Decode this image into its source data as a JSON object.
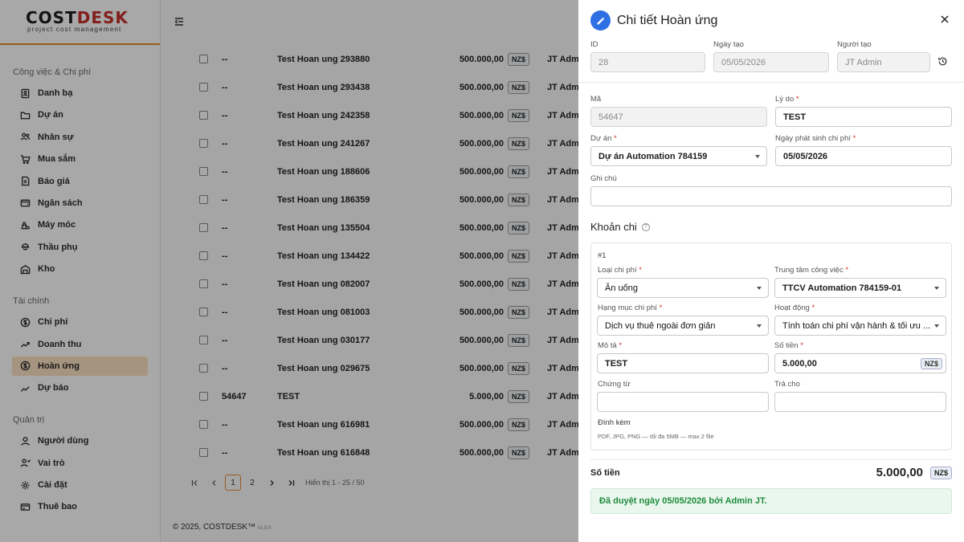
{
  "brand": {
    "name_a": "COST",
    "name_b": "DESK",
    "tagline": "project cost management"
  },
  "sidebar": {
    "sections": [
      {
        "title": "Công việc & Chi phí",
        "items": [
          {
            "label": "Danh bạ",
            "icon": "contacts-icon"
          },
          {
            "label": "Dự án",
            "icon": "folder-icon"
          },
          {
            "label": "Nhân sự",
            "icon": "people-icon"
          },
          {
            "label": "Mua sắm",
            "icon": "cart-icon"
          },
          {
            "label": "Báo giá",
            "icon": "quote-icon"
          },
          {
            "label": "Ngân sách",
            "icon": "budget-icon"
          },
          {
            "label": "Máy móc",
            "icon": "machine-icon"
          },
          {
            "label": "Thầu phụ",
            "icon": "contractor-icon"
          },
          {
            "label": "Kho",
            "icon": "warehouse-icon"
          }
        ]
      },
      {
        "title": "Tài chính",
        "items": [
          {
            "label": "Chi phí",
            "icon": "expense-icon"
          },
          {
            "label": "Doanh thu",
            "icon": "revenue-icon"
          },
          {
            "label": "Hoàn ứng",
            "icon": "refund-icon",
            "active": true
          },
          {
            "label": "Dự báo",
            "icon": "forecast-icon"
          }
        ]
      },
      {
        "title": "Quản trị",
        "items": [
          {
            "label": "Người dùng",
            "icon": "user-icon"
          },
          {
            "label": "Vai trò",
            "icon": "role-icon"
          },
          {
            "label": "Cài đặt",
            "icon": "gear-icon"
          },
          {
            "label": "Thuê bao",
            "icon": "subscription-icon"
          }
        ]
      }
    ]
  },
  "list": {
    "rows": [
      {
        "code": "--",
        "desc": "Test Hoan ung 293880",
        "amount": "500.000,00",
        "currency": "NZ$",
        "user": "JT Adm"
      },
      {
        "code": "--",
        "desc": "Test Hoan ung 293438",
        "amount": "500.000,00",
        "currency": "NZ$",
        "user": "JT Adm"
      },
      {
        "code": "--",
        "desc": "Test Hoan ung 242358",
        "amount": "500.000,00",
        "currency": "NZ$",
        "user": "JT Adm"
      },
      {
        "code": "--",
        "desc": "Test Hoan ung 241267",
        "amount": "500.000,00",
        "currency": "NZ$",
        "user": "JT Adm"
      },
      {
        "code": "--",
        "desc": "Test Hoan ung 188606",
        "amount": "500.000,00",
        "currency": "NZ$",
        "user": "JT Adm"
      },
      {
        "code": "--",
        "desc": "Test Hoan ung 186359",
        "amount": "500.000,00",
        "currency": "NZ$",
        "user": "JT Adm"
      },
      {
        "code": "--",
        "desc": "Test Hoan ung 135504",
        "amount": "500.000,00",
        "currency": "NZ$",
        "user": "JT Adm"
      },
      {
        "code": "--",
        "desc": "Test Hoan ung 134422",
        "amount": "500.000,00",
        "currency": "NZ$",
        "user": "JT Adm"
      },
      {
        "code": "--",
        "desc": "Test Hoan ung 082007",
        "amount": "500.000,00",
        "currency": "NZ$",
        "user": "JT Adm"
      },
      {
        "code": "--",
        "desc": "Test Hoan ung 081003",
        "amount": "500.000,00",
        "currency": "NZ$",
        "user": "JT Adm"
      },
      {
        "code": "--",
        "desc": "Test Hoan ung 030177",
        "amount": "500.000,00",
        "currency": "NZ$",
        "user": "JT Adm"
      },
      {
        "code": "--",
        "desc": "Test Hoan ung 029675",
        "amount": "500.000,00",
        "currency": "NZ$",
        "user": "JT Adm"
      },
      {
        "code": "54647",
        "desc": "TEST",
        "amount": "5.000,00",
        "currency": "NZ$",
        "user": "JT Adm"
      },
      {
        "code": "--",
        "desc": "Test Hoan ung 616981",
        "amount": "500.000,00",
        "currency": "NZ$",
        "user": "JT Adm"
      },
      {
        "code": "--",
        "desc": "Test Hoan ung 616848",
        "amount": "500.000,00",
        "currency": "NZ$",
        "user": "JT Adm"
      }
    ],
    "pager": {
      "current": "1",
      "next": "2",
      "info": "Hiển thị 1 - 25 / 50"
    },
    "footer": "© 2025, COSTDESK™",
    "version": "v1.0.0"
  },
  "drawer": {
    "title": "Chi tiết Hoàn ứng",
    "id_label": "ID",
    "id_value": "28",
    "created_label": "Ngày tạo",
    "created_value": "05/05/2026",
    "creator_label": "Người tạo",
    "creator_value": "JT Admin",
    "code_label": "Mã",
    "code_value": "54647",
    "reason_label": "Lý do",
    "reason_value": "TEST",
    "project_label": "Dự án",
    "project_value": "Dự án Automation 784159",
    "date_label": "Ngày phát sinh chi phí",
    "date_value": "05/05/2026",
    "note_label": "Ghi chú",
    "note_value": "",
    "section_title": "Khoản chi",
    "item": {
      "index": "#1",
      "type_label": "Loại chi phí",
      "type_value": "Ăn uống",
      "center_label": "Trung tâm công việc",
      "center_value": "TTCV Automation 784159-01",
      "category_label": "Hạng mục chi phí",
      "category_value": "Dịch vụ thuê ngoài đơn giản",
      "activity_label": "Hoạt động",
      "activity_value": "Tính toán chi phí vận hành & tối ưu ...",
      "desc_label": "Mô tả",
      "desc_value": "TEST",
      "amount_label": "Số tiền",
      "amount_value": "5.000,00",
      "currency": "NZ$",
      "voucher_label": "Chứng từ",
      "voucher_value": "",
      "payto_label": "Trả cho",
      "payto_value": "",
      "attach_label": "Đính kèm",
      "attach_hint": "PDF, JPG, PNG — tối đa 5MB — max 2 file"
    },
    "total_label": "Số tiền",
    "total_value": "5.000,00",
    "total_currency": "NZ$",
    "approval": "Đã duyệt ngày 05/05/2026 bởi Admin JT."
  }
}
